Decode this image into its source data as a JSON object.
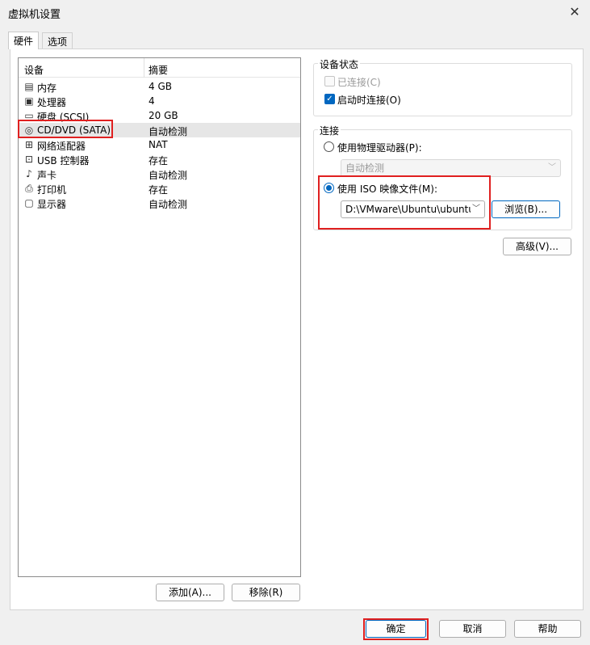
{
  "window": {
    "title": "虚拟机设置",
    "close_icon": "close-icon"
  },
  "tabs": [
    {
      "label": "硬件",
      "active": true
    },
    {
      "label": "选项",
      "active": false
    }
  ],
  "device_list": {
    "columns": [
      "设备",
      "摘要"
    ],
    "rows": [
      {
        "icon": "memory-icon",
        "name": "内存",
        "summary": "4 GB"
      },
      {
        "icon": "processor-icon",
        "name": "处理器",
        "summary": "4"
      },
      {
        "icon": "hard-disk-icon",
        "name": "硬盘 (SCSI)",
        "summary": "20 GB"
      },
      {
        "icon": "cd-dvd-icon",
        "name": "CD/DVD (SATA)",
        "summary": "自动检测",
        "selected": true
      },
      {
        "icon": "network-icon",
        "name": "网络适配器",
        "summary": "NAT"
      },
      {
        "icon": "usb-icon",
        "name": "USB 控制器",
        "summary": "存在"
      },
      {
        "icon": "sound-icon",
        "name": "声卡",
        "summary": "自动检测"
      },
      {
        "icon": "printer-icon",
        "name": "打印机",
        "summary": "存在"
      },
      {
        "icon": "display-icon",
        "name": "显示器",
        "summary": "自动检测"
      }
    ],
    "add_button": "添加(A)...",
    "remove_button": "移除(R)"
  },
  "device_status": {
    "title": "设备状态",
    "connected": {
      "label": "已连接(C)",
      "checked": false,
      "enabled": false
    },
    "connect_at_power_on": {
      "label": "启动时连接(O)",
      "checked": true,
      "enabled": true
    }
  },
  "connection": {
    "title": "连接",
    "physical_drive": {
      "label": "使用物理驱动器(P):",
      "selected": false
    },
    "physical_drive_combo": "自动检测",
    "iso_image": {
      "label": "使用 ISO 映像文件(M):",
      "selected": true
    },
    "iso_path": "D:\\VMware\\Ubuntu\\ubuntu",
    "browse_button": "浏览(B)..."
  },
  "advanced_button": "高级(V)...",
  "footer": {
    "ok": "确定",
    "cancel": "取消",
    "help": "帮助"
  },
  "colors": {
    "accent": "#0067c0",
    "highlight_border": "#e02020",
    "selected_row": "#e6e6e6"
  }
}
